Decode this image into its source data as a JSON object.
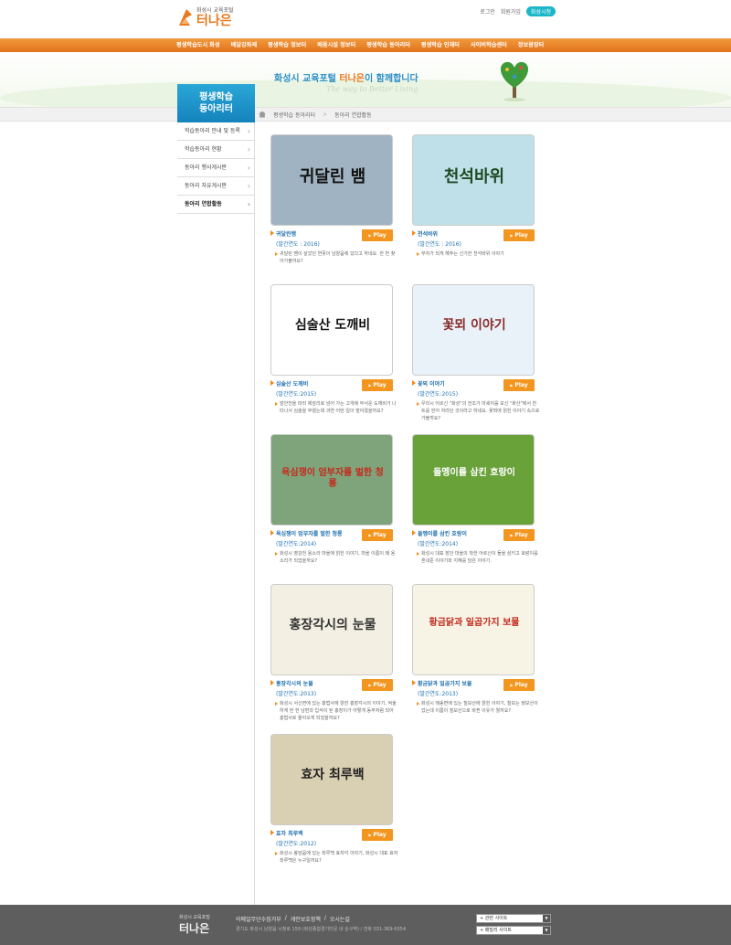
{
  "header": {
    "logo_sub": "화성시 교육포털",
    "logo_main": "터나은",
    "links": [
      "로그인",
      "회원가입"
    ],
    "pill": "화성시청"
  },
  "gnb": [
    "평생학습도시 화성",
    "배달강좌제",
    "평생학습 정보터",
    "배움시설 정보터",
    "평생학습 동아리터",
    "평생학습 인재터",
    "사이버학습센터",
    "정보광장터"
  ],
  "visual": {
    "slogan_prefix": "화성시 교육포털",
    "slogan_brand": "터나은",
    "slogan_suffix": "이 함께합니다",
    "slogan_en": "The way to Better Living"
  },
  "lnb": {
    "title_1": "평생학습",
    "title_2": "동아리터",
    "items": [
      "학습동아리 안내 및 등록",
      "학습동아리 현황",
      "동아리 행사게시판",
      "동아리 자유게시판",
      "동아리 연합활동"
    ]
  },
  "breadcrumb": [
    "평생학습 동아리터",
    "동아리 연합활동"
  ],
  "play_label": "Play",
  "cards": [
    {
      "thumb": "귀달린 뱀",
      "name": "귀달린뱀",
      "year": "(발간연도 : 2016)",
      "desc": "귀달린 뱀이 살았던 연못이 남양읍에 있다고 하네요. 한 번 찾아가볼까요?",
      "bg": "#9fb3c2",
      "color": "#111"
    },
    {
      "thumb": "천석바위",
      "name": "천석바위",
      "year": "(발간연도 : 2016)",
      "desc": "부자가 되게 해주는 신기한 천석바위 이야기",
      "bg": "#bfe0e8",
      "color": "#1d4a22"
    },
    {
      "thumb": "심술산 도깨비",
      "name": "심술산 도깨비",
      "year": "(발간연도:2015)",
      "desc": "발안천을 따라 제암리로 넘어 가는 고개에 무서운 도깨비가 나타나서 심술을 부렸는데 과연 어떤 일이 벌어졌을까요?",
      "bg": "#ffffff",
      "color": "#111"
    },
    {
      "thumb": "꽃뫼 이야기",
      "name": "꽃뫼 이야기",
      "year": "(발간연도:2015)",
      "desc": "우리시 어르신 \"화성\"의 전조가 마세지를 모신 \"화산\"에서 찬트를 얻어 자라던 것이라고 하네요. 꽃뫼에 얽힌 이야기 속으로 가볼까요?",
      "bg": "#e9f2f8",
      "color": "#8a2b2b"
    },
    {
      "thumb": "욕심쟁이 엄부자를 벌한 청룡",
      "name": "욕심쟁이 엄부자를 벌한 청룡",
      "year": "(발간연도:2014)",
      "desc": "화성시 영강천 용소라 마을에 얽힌 이야기, 마을 이름이 왜 용소리가 되었을까요?",
      "bg": "#7fa37a",
      "color": "#c42b1e"
    },
    {
      "thumb": "돌멩이를 삼킨 호랑이",
      "name": "돌멩이를 삼킨 호랑이",
      "year": "(발간연도:2014)",
      "desc": "화성시 대표 장안 마을의 착한 어르신이 돌을 삼키고 호랑이를 혼내준 이야기와 지혜를 담은 이야기.",
      "bg": "#6aa23a",
      "color": "#fff"
    },
    {
      "thumb": "홍장각시의 눈물",
      "name": "홍장각시의 눈물",
      "year": "(발간연도:2013)",
      "desc": "화성시 서신면에 있는 홍법사에 얽힌 홍장각시의 이야기, 억울하게 헌 헌 남편과 입석이 된 홍장이가 어떻게 동무처럼 되어 홍법사로 돌아오게 되었을까요?",
      "bg": "#f3efe2",
      "color": "#333"
    },
    {
      "thumb": "황금닭과 일곱가지 보물",
      "name": "황금닭과 일곱가지 보물",
      "year": "(발간연도:2013)",
      "desc": "화성시 매송면에 있는 칠보산에 얽힌 이야기, 칠보는 정보산이었는데 이름이 칠보산으로 바뀐 이유가 뭘까요?",
      "bg": "#f7f4e6",
      "color": "#c42b1e"
    },
    {
      "thumb": "효자 최루백",
      "name": "효자 최루백",
      "year": "(발간연도:2012)",
      "desc": "화성시 봉담읍에 있는 최루백 효자각 이야기, 화성시 대표 효자 최루백은 누구일까요?",
      "bg": "#d9cfb2",
      "color": "#222"
    }
  ],
  "footer": {
    "logo_sub": "화성시 교육포털",
    "logo_main": "터나은",
    "links": [
      "이메일무단수집거부",
      "/",
      "개인보호정책",
      "/",
      "오시는길"
    ],
    "address": "경기도 화성시 남양읍 시청로 159 (화성종합경기타운 내 순구역) / 전화 031-369-6354",
    "select_1": "+ 관련 사이트",
    "select_2": "+ 패밀리 사이트"
  }
}
